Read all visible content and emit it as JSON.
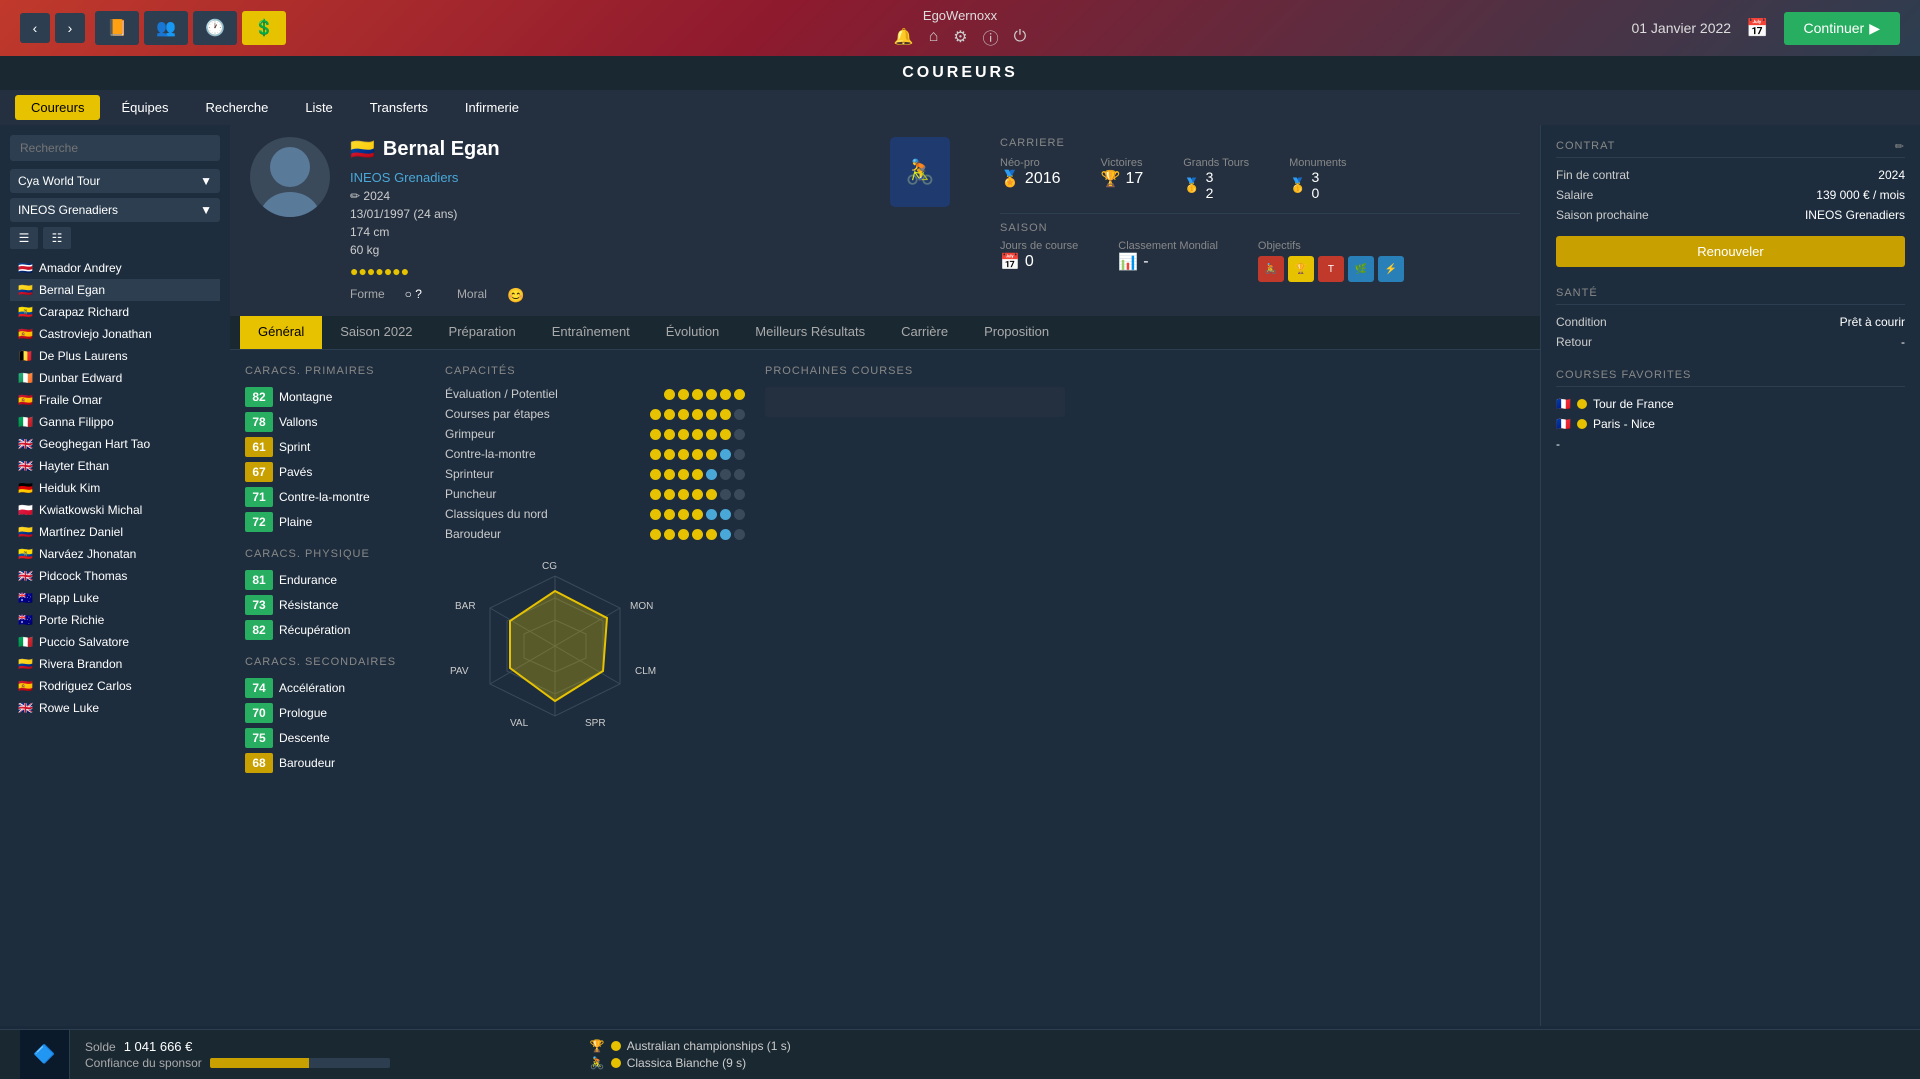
{
  "app": {
    "title": "EgoWernoxx",
    "section": "COUREURS",
    "date": "01 Janvier 2022",
    "continue_label": "Continuer"
  },
  "sub_nav": {
    "items": [
      "Coureurs",
      "Équipes",
      "Recherche",
      "Liste",
      "Transferts",
      "Infirmerie"
    ]
  },
  "sidebar": {
    "search_placeholder": "Recherche",
    "tour_label": "Cya World Tour",
    "team_label": "INEOS Grenadiers",
    "riders": [
      {
        "name": "Amador Andrey",
        "flag": "🇨🇷"
      },
      {
        "name": "Bernal Egan",
        "flag": "🇨🇴"
      },
      {
        "name": "Carapaz Richard",
        "flag": "🇪🇨"
      },
      {
        "name": "Castroviejo Jonathan",
        "flag": "🇪🇸"
      },
      {
        "name": "De Plus Laurens",
        "flag": "🇧🇪"
      },
      {
        "name": "Dunbar Edward",
        "flag": "🇮🇪"
      },
      {
        "name": "Fraile Omar",
        "flag": "🇪🇸"
      },
      {
        "name": "Ganna Filippo",
        "flag": "🇮🇹"
      },
      {
        "name": "Geoghegan Hart Tao",
        "flag": "🇬🇧"
      },
      {
        "name": "Hayter Ethan",
        "flag": "🇬🇧"
      },
      {
        "name": "Heiduk Kim",
        "flag": "🇩🇪"
      },
      {
        "name": "Kwiatkowski Michal",
        "flag": "🇵🇱"
      },
      {
        "name": "Martínez Daniel",
        "flag": "🇨🇴"
      },
      {
        "name": "Narváez Jhonatan",
        "flag": "🇪🇨"
      },
      {
        "name": "Pidcock Thomas",
        "flag": "🇬🇧"
      },
      {
        "name": "Plapp Luke",
        "flag": "🇦🇺"
      },
      {
        "name": "Porte Richie",
        "flag": "🇦🇺"
      },
      {
        "name": "Puccio Salvatore",
        "flag": "🇮🇹"
      },
      {
        "name": "Rivera Brandon",
        "flag": "🇨🇴"
      },
      {
        "name": "Rodriguez Carlos",
        "flag": "🇪🇸"
      },
      {
        "name": "Rowe Luke",
        "flag": "🇬🇧"
      }
    ]
  },
  "rider": {
    "name": "Bernal Egan",
    "flag": "🇨🇴",
    "team": "INEOS Grenadiers",
    "contract_year": "2024",
    "birthdate": "13/01/1997 (24 ans)",
    "height": "174 cm",
    "weight": "60 kg",
    "forme_label": "Forme",
    "moral_label": "Moral",
    "stars": "●●●●●●●",
    "career": {
      "label": "CARRIERE",
      "neo_pro_label": "Néo-pro",
      "neo_pro_year": "2016",
      "victoires_label": "Victoires",
      "victoires_val": "17",
      "grands_tours_label": "Grands Tours",
      "grands_tours_top": "3",
      "grands_tours_bot": "2",
      "monuments_label": "Monuments",
      "monuments_top": "3",
      "monuments_bot": "0"
    },
    "saison": {
      "label": "SAISON",
      "jours_label": "Jours de course",
      "jours_val": "0",
      "classement_label": "Classement Mondial",
      "classement_val": "-",
      "objectifs_label": "Objectifs"
    }
  },
  "tabs": {
    "items": [
      "Général",
      "Saison 2022",
      "Préparation",
      "Entraînement",
      "Évolution",
      "Meilleurs Résultats",
      "Carrière",
      "Proposition"
    ]
  },
  "primary_stats": {
    "title": "CARACS. PRIMAIRES",
    "items": [
      {
        "val": "82",
        "label": "Montagne",
        "color": "green"
      },
      {
        "val": "78",
        "label": "Vallons",
        "color": "green"
      },
      {
        "val": "61",
        "label": "Sprint",
        "color": "yellow"
      },
      {
        "val": "67",
        "label": "Pavés",
        "color": "yellow"
      },
      {
        "val": "71",
        "label": "Contre-la-montre",
        "color": "green"
      },
      {
        "val": "72",
        "label": "Plaine",
        "color": "green"
      }
    ]
  },
  "physical_stats": {
    "title": "CARACS. PHYSIQUE",
    "items": [
      {
        "val": "81",
        "label": "Endurance",
        "color": "green"
      },
      {
        "val": "73",
        "label": "Résistance",
        "color": "green"
      },
      {
        "val": "82",
        "label": "Récupération",
        "color": "green"
      }
    ]
  },
  "secondary_stats": {
    "title": "CARACS. SECONDAIRES",
    "items": [
      {
        "val": "74",
        "label": "Accélération",
        "color": "green"
      },
      {
        "val": "70",
        "label": "Prologue",
        "color": "green"
      },
      {
        "val": "75",
        "label": "Descente",
        "color": "green"
      },
      {
        "val": "68",
        "label": "Baroudeur",
        "color": "yellow"
      }
    ]
  },
  "capacities": {
    "title": "CAPACITÉS",
    "items": [
      {
        "label": "Évaluation / Potentiel",
        "filled": 6,
        "total": 6,
        "type": "yellow"
      },
      {
        "label": "Courses par étapes",
        "filled": 6,
        "total": 7,
        "type": "yellow"
      },
      {
        "label": "Grimpeur",
        "filled": 6,
        "total": 7,
        "type": "yellow"
      },
      {
        "label": "Contre-la-montre",
        "filled": 5,
        "total": 7,
        "type": "mixed"
      },
      {
        "label": "Sprinteur",
        "filled": 4,
        "total": 7,
        "type": "mixed2"
      },
      {
        "label": "Puncheur",
        "filled": 5,
        "total": 7,
        "type": "yellow"
      },
      {
        "label": "Classiques du nord",
        "filled": 4,
        "total": 7,
        "type": "mixed3"
      },
      {
        "label": "Baroudeur",
        "filled": 5,
        "total": 7,
        "type": "mixed4"
      }
    ]
  },
  "radar": {
    "labels": {
      "top": "CG",
      "left": "BAR",
      "right": "MON",
      "mid_left": "PAV",
      "mid_right": "CLM",
      "bot_left": "VAL",
      "bot_right": "SPR"
    }
  },
  "contrat": {
    "title": "CONTRAT",
    "fin_label": "Fin de contrat",
    "fin_val": "2024",
    "salaire_label": "Salaire",
    "salaire_val": "139 000 € / mois",
    "saison_label": "Saison prochaine",
    "saison_val": "INEOS Grenadiers",
    "renew_label": "Renouveler"
  },
  "sante": {
    "title": "SANTÉ",
    "condition_label": "Condition",
    "condition_val": "Prêt à courir",
    "retour_label": "Retour",
    "retour_val": "-"
  },
  "courses_favorites": {
    "title": "COURSES FAVORITES",
    "items": [
      {
        "name": "Tour de France",
        "flag": "🇫🇷"
      },
      {
        "name": "Paris - Nice",
        "flag": "🇫🇷"
      },
      {
        "name": "-",
        "flag": ""
      }
    ]
  },
  "bottom": {
    "solde_label": "Solde",
    "solde_val": "1 041 666 €",
    "sponsor_label": "Confiance du sponsor",
    "sponsor_fill": 55,
    "events": [
      {
        "name": "Australian championships (1 s)"
      },
      {
        "name": "Classica Bianche (9 s)"
      }
    ]
  }
}
